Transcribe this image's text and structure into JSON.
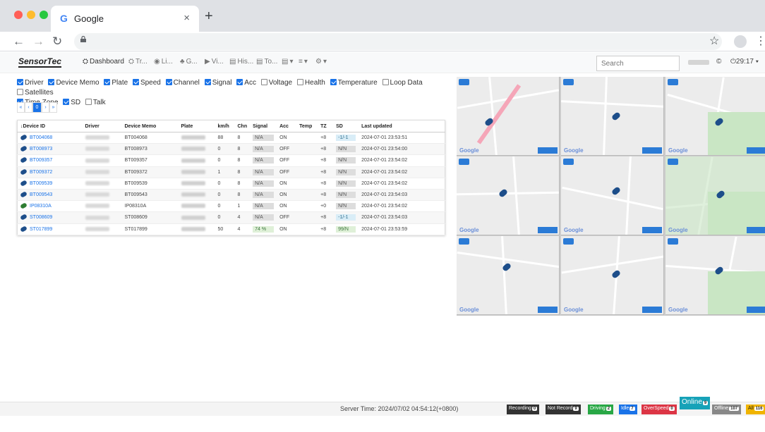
{
  "browser": {
    "tab_title": "Google",
    "tab_favicon": "G",
    "close_glyph": "×",
    "new_tab_glyph": "+"
  },
  "app": {
    "logo": "SensorTec",
    "nav": [
      {
        "icon": "dashboard-icon",
        "label": "Dashboard"
      },
      {
        "icon": "track-icon",
        "label": "Tr..."
      },
      {
        "icon": "live-icon",
        "label": "Li..."
      },
      {
        "icon": "group-icon",
        "label": "G..."
      },
      {
        "icon": "video-icon",
        "label": "Vi..."
      },
      {
        "icon": "history-icon",
        "label": "His..."
      },
      {
        "icon": "tools-icon",
        "label": "To..."
      },
      {
        "icon": "report-icon",
        "label": "▾"
      },
      {
        "icon": "list-icon",
        "label": "▾"
      },
      {
        "icon": "settings-icon",
        "label": "▾"
      }
    ],
    "search_placeholder": "Search",
    "user_time": "29:17"
  },
  "filters": [
    {
      "label": "Driver",
      "checked": true
    },
    {
      "label": "Device Memo",
      "checked": true
    },
    {
      "label": "Plate",
      "checked": true
    },
    {
      "label": "Speed",
      "checked": true
    },
    {
      "label": "Channel",
      "checked": true
    },
    {
      "label": "Signal",
      "checked": true
    },
    {
      "label": "Acc",
      "checked": true
    },
    {
      "label": "Voltage",
      "checked": false
    },
    {
      "label": "Health",
      "checked": false
    },
    {
      "label": "Temperature",
      "checked": true
    },
    {
      "label": "Loop Data",
      "checked": false
    },
    {
      "label": "Satellites",
      "checked": false
    },
    {
      "label": "Time Zone",
      "checked": true
    },
    {
      "label": "SD",
      "checked": true
    },
    {
      "label": "Talk",
      "checked": false
    }
  ],
  "pager": [
    "«",
    "‹",
    "0",
    "›",
    "»"
  ],
  "table": {
    "headers": [
      "↓Device ID",
      "Driver",
      "Device Memo",
      "Plate",
      "km/h",
      "Chn",
      "Signal",
      "Acc",
      "Temp",
      "TZ",
      "SD",
      "Last updated"
    ],
    "rows": [
      {
        "id": "BT004068",
        "memo": "BT004068",
        "kmh": "88",
        "chn": "8",
        "signal": "N/A",
        "acc": "ON",
        "temp": "",
        "tz": "+8",
        "sd": "-1/-1",
        "sd_style": "blue",
        "updated": "2024-07-01 23:53:51",
        "icon": "blue"
      },
      {
        "id": "BT008973",
        "memo": "BT008973",
        "kmh": "0",
        "chn": "8",
        "signal": "N/A",
        "acc": "OFF",
        "temp": "",
        "tz": "+8",
        "sd": "N/N",
        "sd_style": "gray",
        "updated": "2024-07-01 23:54:00",
        "icon": "blue"
      },
      {
        "id": "BT009357",
        "memo": "BT009357",
        "kmh": "0",
        "chn": "8",
        "signal": "N/A",
        "acc": "OFF",
        "temp": "",
        "tz": "+8",
        "sd": "N/N",
        "sd_style": "gray",
        "updated": "2024-07-01 23:54:02",
        "icon": "blue"
      },
      {
        "id": "BT009372",
        "memo": "BT009372",
        "kmh": "1",
        "chn": "8",
        "signal": "N/A",
        "acc": "OFF",
        "temp": "",
        "tz": "+8",
        "sd": "N/N",
        "sd_style": "gray",
        "updated": "2024-07-01 23:54:02",
        "icon": "blue"
      },
      {
        "id": "BT009539",
        "memo": "BT009539",
        "kmh": "0",
        "chn": "8",
        "signal": "N/A",
        "acc": "ON",
        "temp": "",
        "tz": "+8",
        "sd": "N/N",
        "sd_style": "gray",
        "updated": "2024-07-01 23:54:02",
        "icon": "blue"
      },
      {
        "id": "BT009543",
        "memo": "BT009543",
        "kmh": "0",
        "chn": "8",
        "signal": "N/A",
        "acc": "ON",
        "temp": "",
        "tz": "+8",
        "sd": "N/N",
        "sd_style": "gray",
        "updated": "2024-07-01 23:54:03",
        "icon": "blue"
      },
      {
        "id": "IP08310A",
        "memo": "IP08310A",
        "kmh": "0",
        "chn": "1",
        "signal": "N/A",
        "acc": "ON",
        "temp": "",
        "tz": "+0",
        "sd": "N/N",
        "sd_style": "gray",
        "updated": "2024-07-01 23:54:02",
        "icon": "green"
      },
      {
        "id": "ST008609",
        "memo": "ST008609",
        "kmh": "0",
        "chn": "4",
        "signal": "N/A",
        "acc": "OFF",
        "temp": "",
        "tz": "+8",
        "sd": "-1/-1",
        "sd_style": "blue",
        "updated": "2024-07-01 23:54:03",
        "icon": "blue"
      },
      {
        "id": "ST017899",
        "memo": "ST017899",
        "kmh": "50",
        "chn": "4",
        "signal": "74 %",
        "signal_ok": true,
        "acc": "ON",
        "temp": "",
        "tz": "+8",
        "sd": "99/N",
        "sd_style": "green",
        "updated": "2024-07-01 23:53:59",
        "icon": "blue"
      }
    ]
  },
  "maps": {
    "google_mark": "Google"
  },
  "footer": {
    "server_time": "Server Time: 2024/07/02 04:54:12(+0800)",
    "statuses": [
      {
        "label": "Recording",
        "count": "0",
        "color": "#333333"
      },
      {
        "label": "Not Record",
        "count": "9",
        "color": "#333333"
      },
      {
        "label": "Driving",
        "count": "2",
        "color": "#28a745"
      },
      {
        "label": "Idle",
        "count": "7",
        "color": "#1a73e8"
      },
      {
        "label": "OverSpeed",
        "count": "0",
        "color": "#dc3545"
      },
      {
        "label": "Online",
        "count": "9",
        "color": "#17a2b8"
      },
      {
        "label": "Offline",
        "count": "107",
        "color": "#888888"
      },
      {
        "label": "All",
        "count": "116",
        "color": "#f0b400"
      }
    ]
  }
}
